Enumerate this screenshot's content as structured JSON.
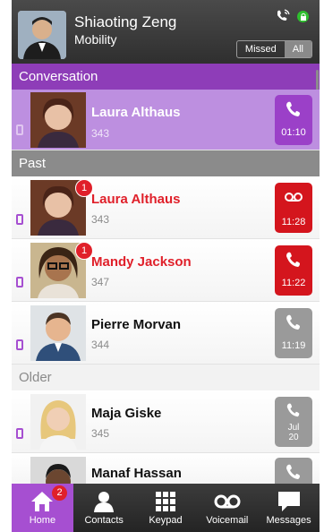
{
  "header": {
    "name": "Shiaoting Zeng",
    "subtitle": "Mobility",
    "filter_missed": "Missed",
    "filter_all": "All",
    "filter_selected": "All"
  },
  "sections": {
    "conversation": "Conversation",
    "past": "Past",
    "older": "Older"
  },
  "rows": [
    {
      "name": "Laura Althaus",
      "number": "343",
      "tile_text": "01:10",
      "kind": "active-call"
    },
    {
      "name": "Laura Althaus",
      "number": "343",
      "tile_text": "11:28",
      "kind": "missed-voicemail",
      "badge": "1"
    },
    {
      "name": "Mandy Jackson",
      "number": "347",
      "tile_text": "11:22",
      "kind": "missed-call",
      "badge": "1"
    },
    {
      "name": "Pierre Morvan",
      "number": "344",
      "tile_text": "11:19",
      "kind": "call"
    },
    {
      "name": "Maja Giske",
      "number": "345",
      "tile_date_line1": "Jul",
      "tile_date_line2": "20",
      "kind": "call"
    },
    {
      "name": "Manaf Hassan",
      "number": "",
      "kind": "call"
    }
  ],
  "tabs": [
    {
      "label": "Home",
      "badge": "2",
      "icon": "home-icon"
    },
    {
      "label": "Contacts",
      "icon": "contacts-icon"
    },
    {
      "label": "Keypad",
      "icon": "keypad-icon"
    },
    {
      "label": "Voicemail",
      "icon": "voicemail-icon"
    },
    {
      "label": "Messages",
      "icon": "messages-icon"
    }
  ],
  "colors": {
    "accent_purple": "#a64fd1",
    "missed_red": "#d4151d",
    "header_dark": "#3a3a3a"
  }
}
